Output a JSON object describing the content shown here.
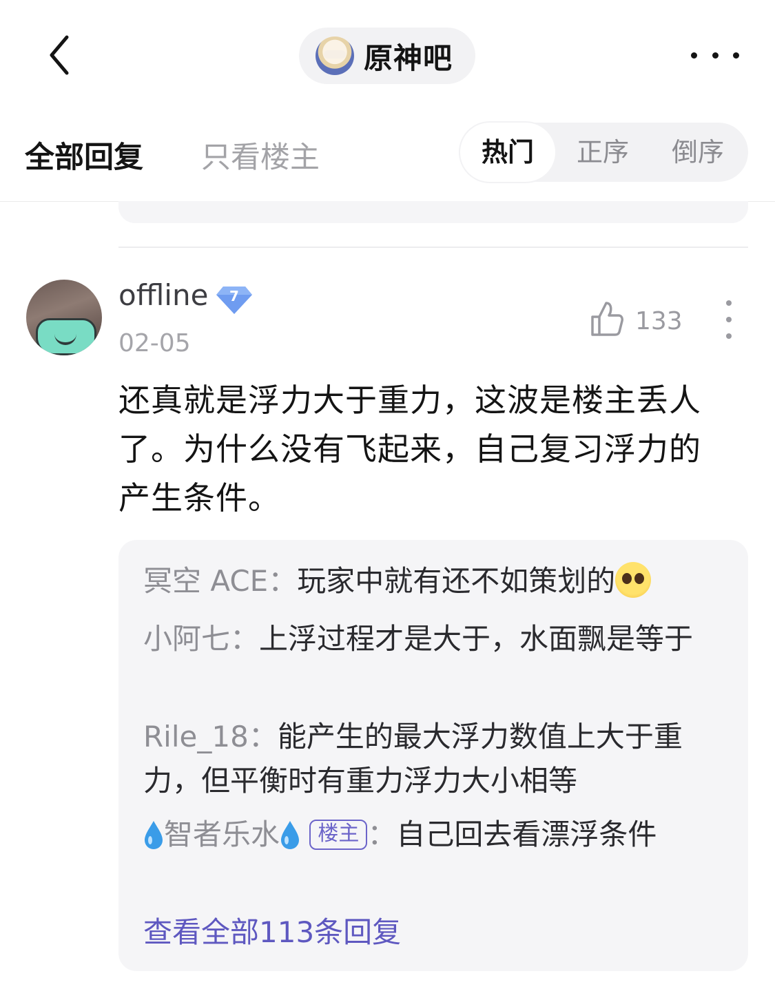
{
  "header": {
    "back_icon": "chevron-left-icon",
    "forum_name": "原神吧",
    "more_icon": "more-horizontal-icon"
  },
  "filter": {
    "tab_all": "全部回复",
    "tab_op_only": "只看楼主",
    "sort_options": [
      "热门",
      "正序",
      "倒序"
    ],
    "sort_selected": "热门"
  },
  "post": {
    "username": "offline",
    "level": "7",
    "date": "02-05",
    "likes": "133",
    "body": "还真就是浮力大于重力，这波是楼主丢人了。为什么没有飞起来，自己复习浮力的产生条件。"
  },
  "replies": {
    "items": [
      {
        "name": "冥空 ACE",
        "sep": "：",
        "text": "玩家中就有还不如策划的"
      },
      {
        "name": "小阿七",
        "sep": "：",
        "text": "上浮过程才是大于，水面飘是等于"
      },
      {
        "name": "Rile_18",
        "sep": "：",
        "text": "能产生的最大浮力数值上大于重力，但平衡时有重力浮力大小相等"
      },
      {
        "name": "智者乐水",
        "op_tag": "楼主",
        "sep": "：",
        "text": "自己回去看漂浮条件"
      }
    ],
    "view_all": "查看全部113条回复"
  },
  "colors": {
    "accent_purple": "#5e58c0",
    "level_badge": "#6f9cf0",
    "text_primary": "#141414",
    "text_muted": "#a3a3a7"
  }
}
